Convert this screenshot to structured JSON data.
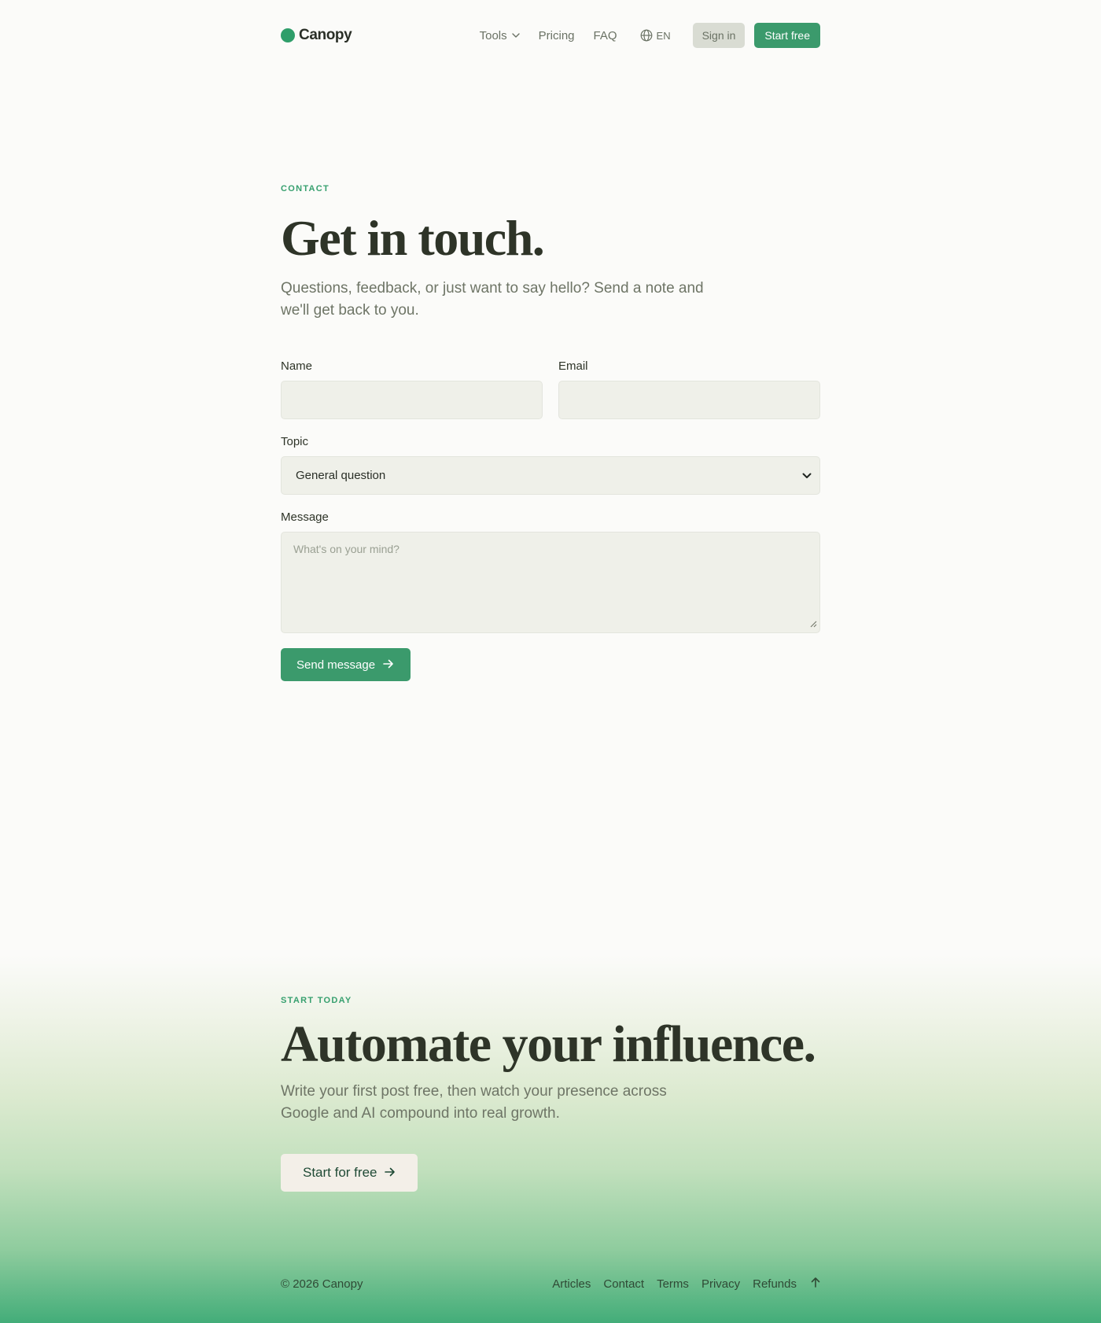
{
  "brand": {
    "name": "Canopy",
    "accent": "#3b9a6c"
  },
  "nav": {
    "tools": "Tools",
    "pricing": "Pricing",
    "faq": "FAQ",
    "language": "EN",
    "sign_in": "Sign in",
    "start_free": "Start free"
  },
  "hero": {
    "eyebrow": "CONTACT",
    "title": "Get in touch.",
    "lead": "Questions, feedback, or just want to say hello? Send a note and we'll get back to you."
  },
  "form": {
    "name_label": "Name",
    "name_value": "",
    "email_label": "Email",
    "email_value": "",
    "topic_label": "Topic",
    "topic_value": "General question",
    "message_label": "Message",
    "message_placeholder": "What's on your mind?",
    "submit_label": "Send message"
  },
  "cta": {
    "eyebrow": "START TODAY",
    "title": "Automate your influence.",
    "lead": "Write your first post free, then watch your presence across Google and AI compound into real growth.",
    "button_label": "Start for free"
  },
  "footer": {
    "copyright": "© 2026 Canopy",
    "links": [
      "Articles",
      "Contact",
      "Terms",
      "Privacy",
      "Refunds"
    ],
    "back_to_top_icon": "arrow-up-icon"
  }
}
